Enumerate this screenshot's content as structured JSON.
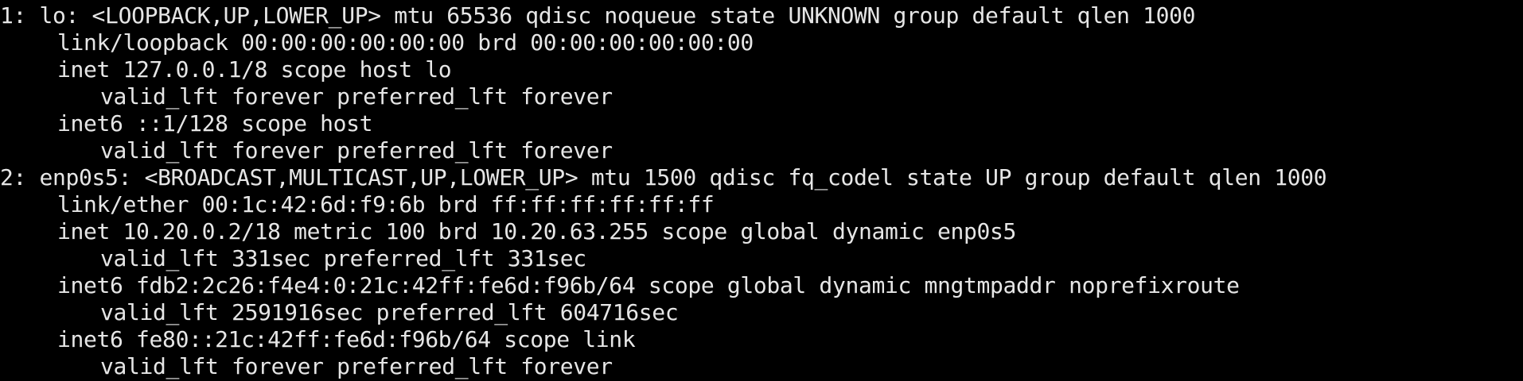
{
  "terminal": {
    "colors": {
      "background": "#000000",
      "foreground": "#e6e6e6"
    },
    "lines": [
      "1: lo: <LOOPBACK,UP,LOWER_UP> mtu 65536 qdisc noqueue state UNKNOWN group default qlen 1000",
      "link/loopback 00:00:00:00:00:00 brd 00:00:00:00:00:00",
      "inet 127.0.0.1/8 scope host lo",
      "valid_lft forever preferred_lft forever",
      "inet6 ::1/128 scope host",
      "valid_lft forever preferred_lft forever",
      "2: enp0s5: <BROADCAST,MULTICAST,UP,LOWER_UP> mtu 1500 qdisc fq_codel state UP group default qlen 1000",
      "link/ether 00:1c:42:6d:f9:6b brd ff:ff:ff:ff:ff:ff",
      "inet 10.20.0.2/18 metric 100 brd 10.20.63.255 scope global dynamic enp0s5",
      "valid_lft 331sec preferred_lft 331sec",
      "inet6 fdb2:2c26:f4e4:0:21c:42ff:fe6d:f96b/64 scope global dynamic mngtmpaddr noprefixroute",
      "valid_lft 2591916sec preferred_lft 604716sec",
      "inet6 fe80::21c:42ff:fe6d:f96b/64 scope link",
      "valid_lft forever preferred_lft forever"
    ]
  }
}
